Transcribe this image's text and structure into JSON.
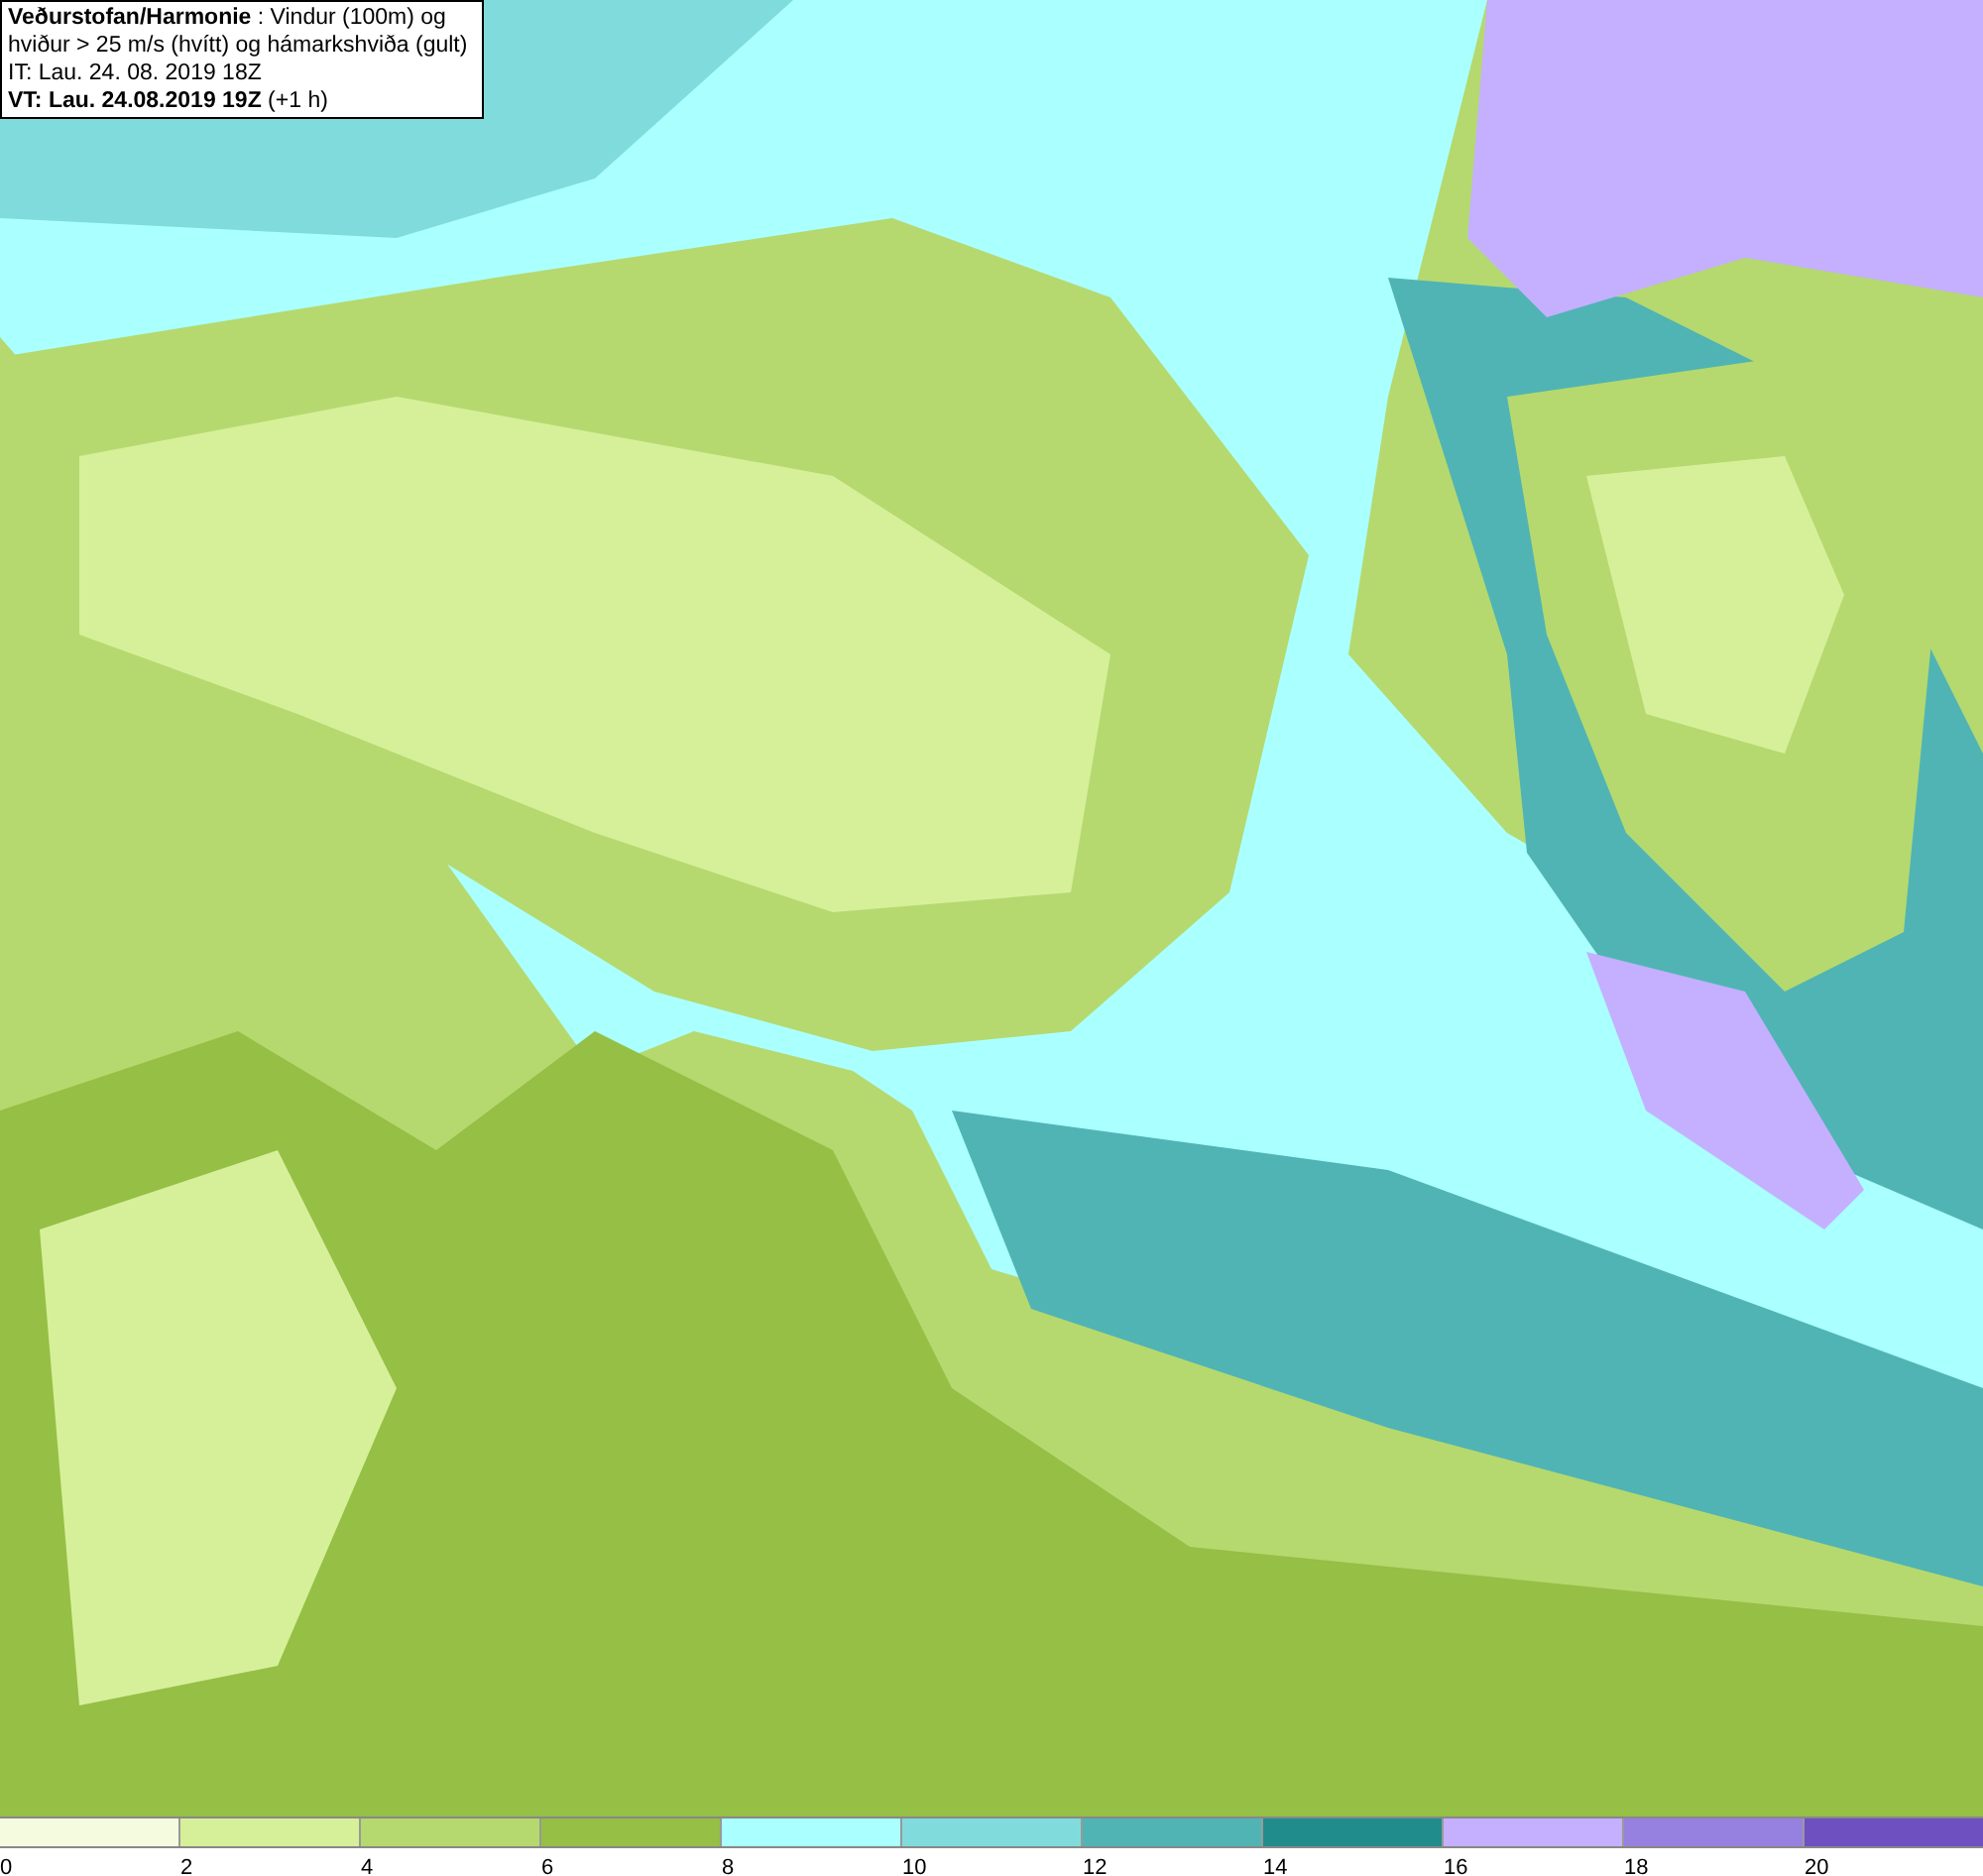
{
  "info_box": {
    "title": "**Veðurstofan/Harmonie** : Vindur (100m) og hviður > 25 m/s (hvítt) og hámarkshviða (gult)",
    "issue_time": "IT: Lau. 24. 08. 2019 18Z",
    "valid_time": "**VT: Lau. 24.08.2019 19Z** (+1 h)"
  },
  "legend": {
    "bins": [
      {
        "color": "#f5fbdf",
        "label": "0"
      },
      {
        "color": "#d6f09a",
        "label": "2"
      },
      {
        "color": "#b5d96e",
        "label": "4"
      },
      {
        "color": "#95bf45",
        "label": "6"
      },
      {
        "color": "#aaffff",
        "label": "8"
      },
      {
        "color": "#80dcdc",
        "label": "10"
      },
      {
        "color": "#50b4b4",
        "label": "12"
      },
      {
        "color": "#208c8c",
        "label": "14"
      },
      {
        "color": "#c4b0ff",
        "label": "16"
      },
      {
        "color": "#9680e0",
        "label": "18"
      },
      {
        "color": "#6e50c0",
        "label": "20"
      }
    ]
  }
}
